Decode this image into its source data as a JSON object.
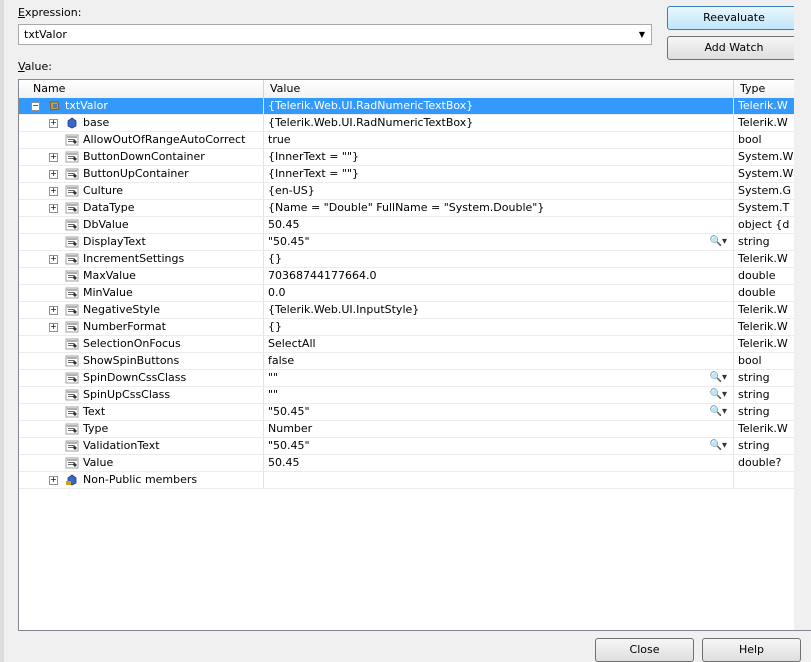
{
  "expression": {
    "label_prefix": "E",
    "label_rest": "xpression:",
    "value": "txtValor"
  },
  "value_label": {
    "prefix": "V",
    "rest": "alue:"
  },
  "buttons": {
    "reevaluate": "Reevaluate",
    "add_watch": "Add Watch",
    "close": "Close",
    "help": "Help"
  },
  "columns": {
    "name": "Name",
    "value": "Value",
    "type": "Type"
  },
  "rows": [
    {
      "name": "txtValor",
      "value": "{Telerik.Web.UI.RadNumericTextBox}",
      "type": "Telerik.W",
      "level": 0,
      "expander": "minus",
      "icon": "object-icon",
      "selected": true,
      "mag": false
    },
    {
      "name": "base",
      "value": "{Telerik.Web.UI.RadNumericTextBox}",
      "type": "Telerik.W",
      "level": 1,
      "expander": "plus",
      "icon": "base-icon",
      "mag": false
    },
    {
      "name": "AllowOutOfRangeAutoCorrect",
      "value": "true",
      "type": "bool",
      "level": 1,
      "expander": "",
      "icon": "property-icon",
      "mag": false
    },
    {
      "name": "ButtonDownContainer",
      "value": "{InnerText = \"\"}",
      "type": "System.W",
      "level": 1,
      "expander": "plus",
      "icon": "property-icon",
      "mag": false
    },
    {
      "name": "ButtonUpContainer",
      "value": "{InnerText = \"\"}",
      "type": "System.W",
      "level": 1,
      "expander": "plus",
      "icon": "property-icon",
      "mag": false
    },
    {
      "name": "Culture",
      "value": "{en-US}",
      "type": "System.G",
      "level": 1,
      "expander": "plus",
      "icon": "property-icon",
      "mag": false
    },
    {
      "name": "DataType",
      "value": "{Name = \"Double\" FullName = \"System.Double\"}",
      "type": "System.T",
      "level": 1,
      "expander": "plus",
      "icon": "property-icon",
      "mag": false
    },
    {
      "name": "DbValue",
      "value": "50.45",
      "type": "object {d",
      "level": 1,
      "expander": "",
      "icon": "property-icon",
      "mag": false
    },
    {
      "name": "DisplayText",
      "value": "\"50.45\"",
      "type": "string",
      "level": 1,
      "expander": "",
      "icon": "property-icon",
      "mag": true
    },
    {
      "name": "IncrementSettings",
      "value": "{}",
      "type": "Telerik.W",
      "level": 1,
      "expander": "plus",
      "icon": "property-icon",
      "mag": false
    },
    {
      "name": "MaxValue",
      "value": "70368744177664.0",
      "type": "double",
      "level": 1,
      "expander": "",
      "icon": "property-icon",
      "mag": false
    },
    {
      "name": "MinValue",
      "value": "0.0",
      "type": "double",
      "level": 1,
      "expander": "",
      "icon": "property-icon",
      "mag": false
    },
    {
      "name": "NegativeStyle",
      "value": "{Telerik.Web.UI.InputStyle}",
      "type": "Telerik.W",
      "level": 1,
      "expander": "plus",
      "icon": "property-icon",
      "mag": false
    },
    {
      "name": "NumberFormat",
      "value": "{}",
      "type": "Telerik.W",
      "level": 1,
      "expander": "plus",
      "icon": "property-icon",
      "mag": false
    },
    {
      "name": "SelectionOnFocus",
      "value": "SelectAll",
      "type": "Telerik.W",
      "level": 1,
      "expander": "",
      "icon": "property-icon",
      "mag": false
    },
    {
      "name": "ShowSpinButtons",
      "value": "false",
      "type": "bool",
      "level": 1,
      "expander": "",
      "icon": "property-icon",
      "mag": false
    },
    {
      "name": "SpinDownCssClass",
      "value": "\"\"",
      "type": "string",
      "level": 1,
      "expander": "",
      "icon": "property-icon",
      "mag": true
    },
    {
      "name": "SpinUpCssClass",
      "value": "\"\"",
      "type": "string",
      "level": 1,
      "expander": "",
      "icon": "property-icon",
      "mag": true
    },
    {
      "name": "Text",
      "value": "\"50.45\"",
      "type": "string",
      "level": 1,
      "expander": "",
      "icon": "property-icon",
      "mag": true
    },
    {
      "name": "Type",
      "value": "Number",
      "type": "Telerik.W",
      "level": 1,
      "expander": "",
      "icon": "property-icon",
      "mag": false
    },
    {
      "name": "ValidationText",
      "value": "\"50.45\"",
      "type": "string",
      "level": 1,
      "expander": "",
      "icon": "property-icon",
      "mag": true
    },
    {
      "name": "Value",
      "value": "50.45",
      "type": "double?",
      "level": 1,
      "expander": "",
      "icon": "property-icon",
      "mag": false
    },
    {
      "name": "Non-Public members",
      "value": "",
      "type": "",
      "level": 1,
      "expander": "plus",
      "icon": "nonpublic-icon",
      "mag": false
    }
  ],
  "colors": {
    "selection": "#3399ff",
    "window": "#f0f0f0"
  }
}
